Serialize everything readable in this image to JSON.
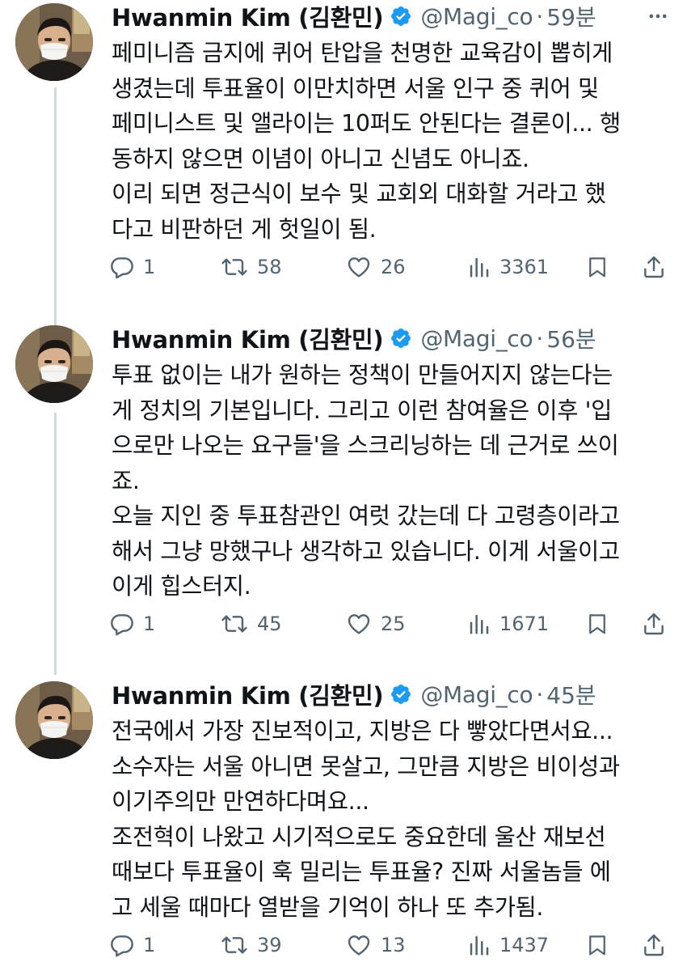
{
  "tweets": [
    {
      "name": "Hwanmin Kim (김환민)",
      "handle": "@Magi_co",
      "separator": "·",
      "time": "59분",
      "lines": [
        "페미니즘 금지에 퀴어 탄압을 천명한 교육감이 뽑히게",
        "생겼는데 투표율이 이만치하면 서울 인구 중 퀴어 및",
        "페미니스트 및 앨라이는 10퍼도 안된다는 결론이... 행",
        "동하지 않으면 이념이 아니고 신념도 아니죠.",
        "이리 되면 정근식이 보수 및 교회외 대화할 거라고 했",
        "다고 비판하던 게 헛일이 됨."
      ],
      "replies": "1",
      "retweets": "58",
      "likes": "26",
      "views": "3361"
    },
    {
      "name": "Hwanmin Kim (김환민)",
      "handle": "@Magi_co",
      "separator": "·",
      "time": "56분",
      "lines": [
        "투표 없이는 내가 원하는 정책이 만들어지지 않는다는",
        "게 정치의 기본입니다. 그리고 이런 참여율은 이후 '입",
        "으로만 나오는 요구들'을 스크리닝하는 데 근거로 쓰이",
        "죠.",
        "오늘 지인 중 투표참관인 여럿 갔는데 다 고령층이라고",
        "해서 그냥 망했구나 생각하고 있습니다. 이게 서울이고",
        "이게 힙스터지."
      ],
      "replies": "1",
      "retweets": "45",
      "likes": "25",
      "views": "1671"
    },
    {
      "name": "Hwanmin Kim (김환민)",
      "handle": "@Magi_co",
      "separator": "·",
      "time": "45분",
      "lines": [
        "전국에서 가장 진보적이고, 지방은 다 빻았다면서요...",
        "소수자는 서울 아니면 못살고, 그만큼 지방은 비이성과",
        "이기주의만 만연하다며요...",
        "조전혁이 나왔고 시기적으로도 중요한데 울산 재보선",
        "때보다 투표율이 훅 밀리는 투표율? 진짜 서울놈들 에",
        "고 세울 때마다 열받을 기억이 하나 또 추가됨."
      ],
      "replies": "1",
      "retweets": "39",
      "likes": "13",
      "views": "1437"
    }
  ],
  "icons": {
    "verified": "verified-badge-icon",
    "more": "more-options-icon",
    "reply": "reply-icon",
    "retweet": "retweet-icon",
    "like": "like-icon",
    "views": "views-icon",
    "bookmark": "bookmark-icon",
    "share": "share-icon"
  },
  "colors": {
    "verified": "#1d9bf0",
    "text": "#0f1419",
    "secondary": "#536471",
    "thread_line": "#cfd9de"
  }
}
